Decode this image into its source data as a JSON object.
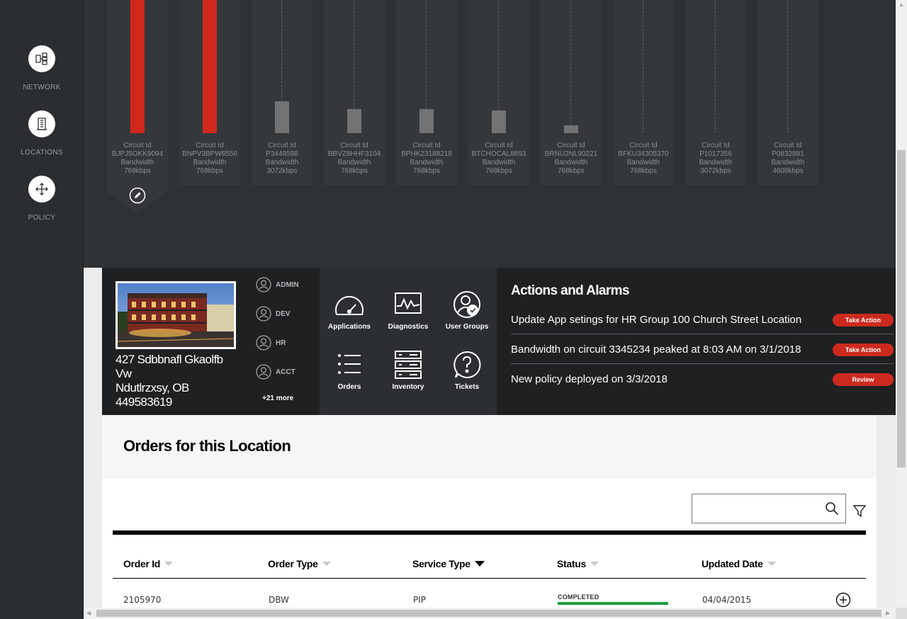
{
  "sidebar": {
    "items": [
      {
        "label": "NETWORK",
        "icon": "network-icon"
      },
      {
        "label": "LOCATIONS",
        "icon": "building-icon"
      },
      {
        "label": "POLICY",
        "icon": "move-arrows-icon"
      }
    ]
  },
  "circuits": [
    {
      "id_label": "Circuit Id",
      "id": "BJPJ5OKK9094",
      "bw_label": "Bandwidth",
      "bandwidth": "768kbps",
      "utilization": 1.0,
      "alert": true,
      "selected": true
    },
    {
      "id_label": "Circuit Id",
      "id": "BNPV3BPW8556",
      "bw_label": "Bandwidth",
      "bandwidth": "768kbps",
      "utilization": 1.0,
      "alert": true,
      "selected": false
    },
    {
      "id_label": "Circuit Id",
      "id": "P3449598",
      "bw_label": "Bandwidth",
      "bandwidth": "3072kbps",
      "utilization": 0.24,
      "alert": false,
      "selected": false
    },
    {
      "id_label": "Circuit Id",
      "id": "BBVZ8HHF3104",
      "bw_label": "Bandwidth",
      "bandwidth": "768kbps",
      "utilization": 0.18,
      "alert": false,
      "selected": false
    },
    {
      "id_label": "Circuit Id",
      "id": "BPHK23188218",
      "bw_label": "Bandwidth",
      "bandwidth": "768kbps",
      "utilization": 0.18,
      "alert": false,
      "selected": false
    },
    {
      "id_label": "Circuit Id",
      "id": "BTCHOCAL8893",
      "bw_label": "Bandwidth",
      "bandwidth": "768kbps",
      "utilization": 0.17,
      "alert": false,
      "selected": false
    },
    {
      "id_label": "Circuit Id",
      "id": "BRNU2NL90221",
      "bw_label": "Bandwidth",
      "bandwidth": "768kbps",
      "utilization": 0.06,
      "alert": false,
      "selected": false
    },
    {
      "id_label": "Circuit Id",
      "id": "BFKU34305370",
      "bw_label": "Bandwidth",
      "bandwidth": "768kbps",
      "utilization": 0.0,
      "alert": false,
      "selected": false
    },
    {
      "id_label": "Circuit Id",
      "id": "P1017356",
      "bw_label": "Bandwidth",
      "bandwidth": "3072kbps",
      "utilization": 0.0,
      "alert": false,
      "selected": false
    },
    {
      "id_label": "Circuit Id",
      "id": "P0832881",
      "bw_label": "Bandwidth",
      "bandwidth": "4608kbps",
      "utilization": 0.0,
      "alert": false,
      "selected": false
    }
  ],
  "location": {
    "address_line1": "427 Sdbbnafl Gkaolfb",
    "address_line2": "Vw",
    "address_line3": "Ndutlrzxsy, OB",
    "address_line4": "449583619",
    "user_groups": [
      "ADMIN",
      "DEV",
      "HR",
      "ACCT"
    ],
    "more_label": "+21 more"
  },
  "tools": [
    {
      "label": "Applications",
      "icon": "speedometer-icon"
    },
    {
      "label": "Diagnostics",
      "icon": "pulse-chart-icon"
    },
    {
      "label": "User Groups",
      "icon": "user-check-icon"
    },
    {
      "label": "Orders",
      "icon": "list-icon"
    },
    {
      "label": "Inventory",
      "icon": "server-icon"
    },
    {
      "label": "Tickets",
      "icon": "question-bubble-icon"
    }
  ],
  "actions": {
    "title": "Actions and Alarms",
    "items": [
      {
        "text": "Update App setings for HR Group 100 Church Street Location",
        "button": "Take Action"
      },
      {
        "text": "Bandwidth on circuit 3345234 peaked at 8:03 AM on 3/1/2018",
        "button": "Take Action"
      },
      {
        "text": "New policy deployed on 3/3/2018",
        "button": "Review"
      }
    ]
  },
  "orders": {
    "title": "Orders for this Location",
    "search": {
      "value": "",
      "placeholder": ""
    },
    "columns": [
      "Order Id",
      "Order Type",
      "Service Type",
      "Status",
      "Updated Date"
    ],
    "sort_column": "Service Type",
    "rows": [
      {
        "order_id": "2105970",
        "order_type": "DBW",
        "service_type": "PIP",
        "status": "COMPLETED",
        "status_progress": 1.0,
        "updated_date": "04/04/2015"
      }
    ]
  },
  "colors": {
    "alert_bar": "#d1281d",
    "normal_bar": "#737373",
    "action_button": "#cd2a1f",
    "status_complete": "#1b9c43"
  }
}
